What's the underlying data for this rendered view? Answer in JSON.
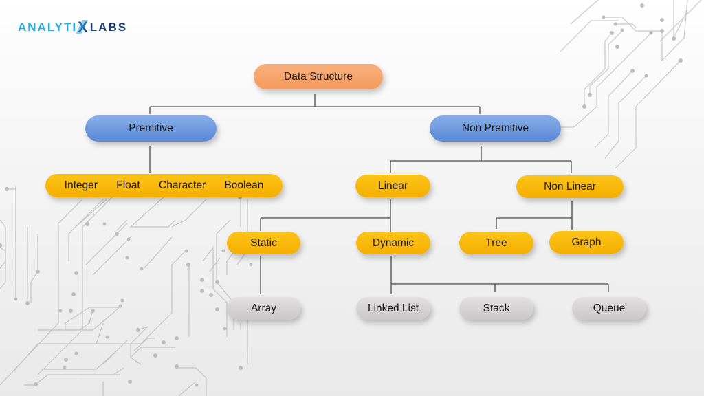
{
  "brand": {
    "part1": "ANALYTI",
    "part2": "X",
    "part3": "LABS"
  },
  "colors": {
    "root": "#f59a5e",
    "category": "#5a88d6",
    "type": "#f4ae00",
    "leaf": "#c9c7c7",
    "connector": "#444444",
    "brand_light": "#29a9e1",
    "brand_dark": "#1c3f78"
  },
  "tree": {
    "root": "Data Structure",
    "primitive": {
      "label": "Premitive",
      "types": [
        "Integer",
        "Float",
        "Character",
        "Boolean"
      ]
    },
    "non_primitive": {
      "label": "Non Premitive",
      "linear": {
        "label": "Linear",
        "static": {
          "label": "Static",
          "children": [
            "Array"
          ]
        },
        "dynamic": {
          "label": "Dynamic",
          "children": [
            "Linked List",
            "Stack",
            "Queue"
          ]
        }
      },
      "non_linear": {
        "label": "Non Linear",
        "children": [
          "Tree",
          "Graph"
        ]
      }
    }
  }
}
